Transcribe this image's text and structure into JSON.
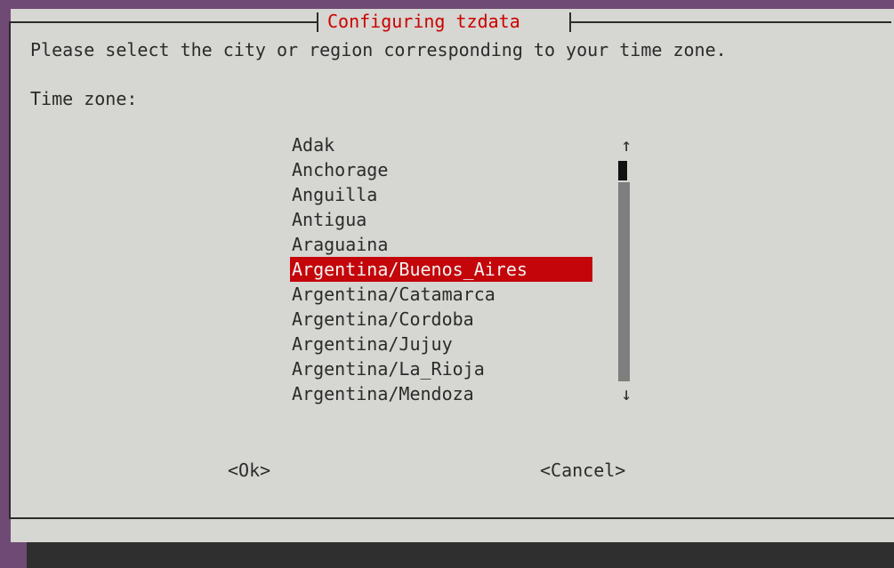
{
  "dialog": {
    "title": "Configuring tzdata",
    "prompt": "Please select the city or region corresponding to your time zone.",
    "field_label": "Time zone:"
  },
  "timezone_list": {
    "items": [
      "Adak",
      "Anchorage",
      "Anguilla",
      "Antigua",
      "Araguaina",
      "Argentina/Buenos_Aires",
      "Argentina/Catamarca",
      "Argentina/Cordoba",
      "Argentina/Jujuy",
      "Argentina/La_Rioja",
      "Argentina/Mendoza"
    ],
    "selected_index": 5
  },
  "scrollbar": {
    "up_glyph": "↑",
    "down_glyph": "↓"
  },
  "buttons": {
    "ok_label": "<Ok>",
    "cancel_label": "<Cancel>"
  },
  "colors": {
    "background": "#6f4a74",
    "dialog_bg": "#d6d6d2",
    "title_color": "#cc0000",
    "selection_bg": "#c4050a",
    "selection_fg": "#f2f2f2",
    "scroll_track": "#7e7e7e"
  }
}
